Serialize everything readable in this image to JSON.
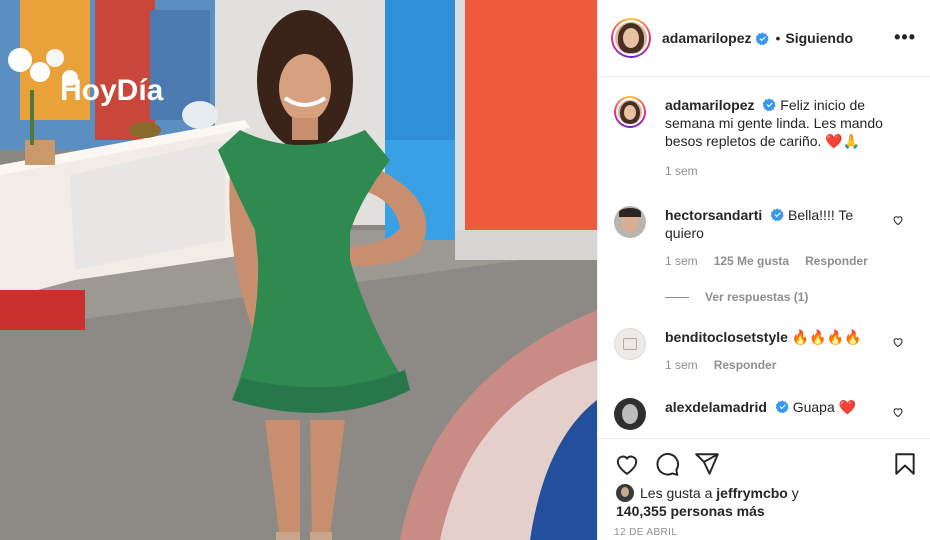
{
  "post": {
    "author": "adamarilopez",
    "separator": "•",
    "follow_status": "Siguiendo",
    "more_icon": "more-horizontal-icon",
    "caption": {
      "author": "adamarilopez",
      "text": "Feliz inicio de semana mi gente linda. Les mando besos repletos de cariño. ❤️🙏",
      "time": "1 sem"
    },
    "photo": {
      "studio_sign": "HoyDía"
    }
  },
  "comments": [
    {
      "author": "hectorsandarti",
      "verified": true,
      "text": "Bella!!!! Te quiero",
      "time": "1 sem",
      "likes": "125 Me gusta",
      "reply_label": "Responder",
      "view_replies": "Ver respuestas (1)"
    },
    {
      "author": "benditoclosetstyle",
      "verified": false,
      "text": "🔥🔥🔥🔥",
      "time": "1 sem",
      "reply_label": "Responder"
    },
    {
      "author": "alexdelamadrid",
      "verified": true,
      "text": "Guapa ❤️"
    }
  ],
  "actions": {
    "like_icon": "heart-icon",
    "comment_icon": "comment-icon",
    "share_icon": "send-icon",
    "save_icon": "bookmark-icon"
  },
  "likes_summary": {
    "prefix": "Les gusta a",
    "user": "jeffrymcbo",
    "joiner": "y",
    "count": "140,355 personas más"
  },
  "date": "12 DE ABRIL",
  "colors": {
    "verified": "#3897f0",
    "muted": "#8e8e8e",
    "text": "#262626",
    "dress": "#2e8a4e"
  }
}
